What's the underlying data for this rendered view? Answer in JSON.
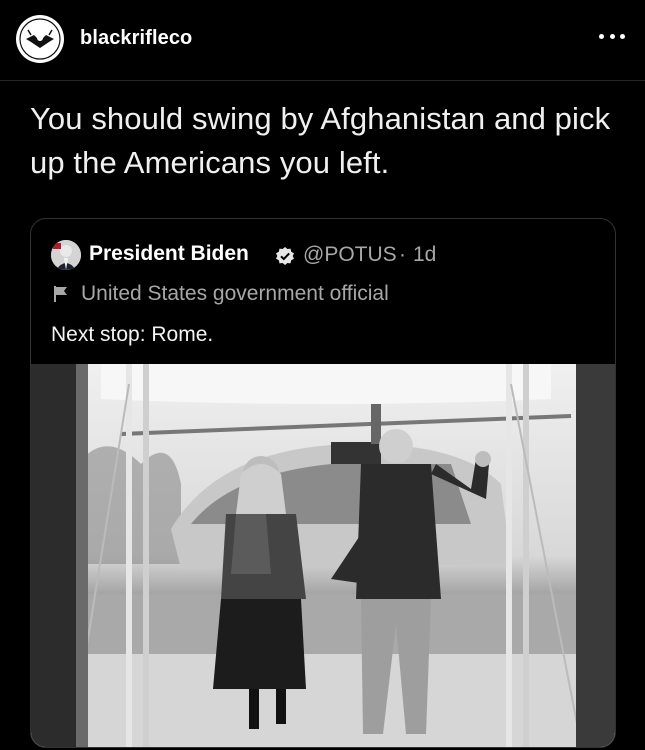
{
  "post": {
    "username": "blackrifleco",
    "caption": "You should swing by Afghanistan and pick up the Americans you left."
  },
  "quoted": {
    "name": "President Biden",
    "handle": "@POTUS",
    "dot": "·",
    "time": "1d",
    "label": "United States government official",
    "text": "Next stop: Rome."
  },
  "icons": {
    "more": "more-options-icon",
    "verified": "verified-badge-icon",
    "flag": "government-flag-icon"
  }
}
